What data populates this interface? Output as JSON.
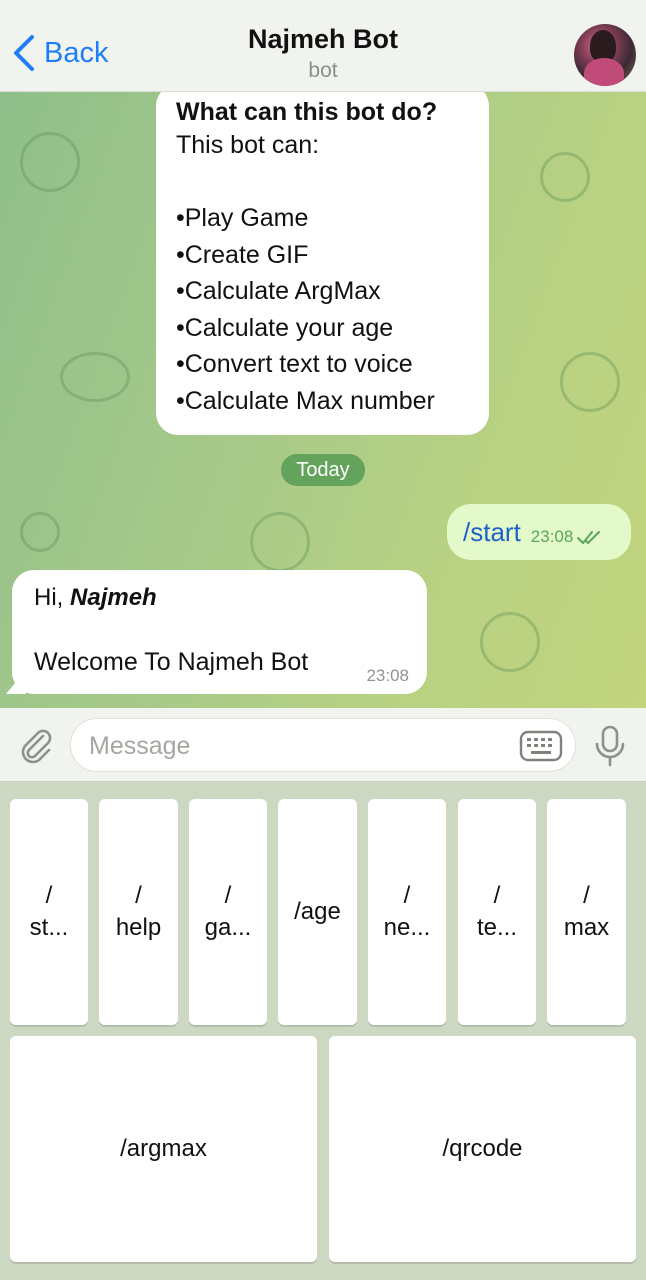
{
  "header": {
    "back_label": "Back",
    "title": "Najmeh Bot",
    "subtitle": "bot"
  },
  "info_card": {
    "title": "What can this bot do?",
    "intro": "This bot can:",
    "items": [
      "•Play Game",
      "•Create GIF",
      "•Calculate ArgMax",
      "•Calculate your age",
      "•Convert text to voice",
      "•Calculate Max number"
    ]
  },
  "date_separator": "Today",
  "messages": [
    {
      "direction": "outgoing",
      "text": "/start",
      "time": "23:08",
      "status": "read"
    },
    {
      "direction": "incoming",
      "greeting": "Hi,",
      "name": "Najmeh",
      "text": "Welcome To Najmeh Bot",
      "time": "23:08"
    }
  ],
  "composer": {
    "placeholder": "Message"
  },
  "keyboard": {
    "row1": [
      {
        "line1": "/",
        "line2": "st..."
      },
      {
        "line1": "/",
        "line2": "help"
      },
      {
        "line1": "/",
        "line2": "ga..."
      },
      {
        "line1": "/age",
        "line2": ""
      },
      {
        "line1": "/",
        "line2": "ne..."
      },
      {
        "line1": "/",
        "line2": "te..."
      },
      {
        "line1": "/",
        "line2": "max"
      }
    ],
    "row2": [
      {
        "label": "/argmax"
      },
      {
        "label": "/qrcode"
      }
    ]
  },
  "colors": {
    "accent": "#1e7ef7",
    "outgoing_bubble": "#e3f9c9",
    "date_pill": "#63a35c",
    "read_check": "#5aa65a"
  },
  "icons": [
    "chevron-left-icon",
    "paperclip-icon",
    "keyboard-icon",
    "microphone-icon",
    "double-check-icon"
  ]
}
